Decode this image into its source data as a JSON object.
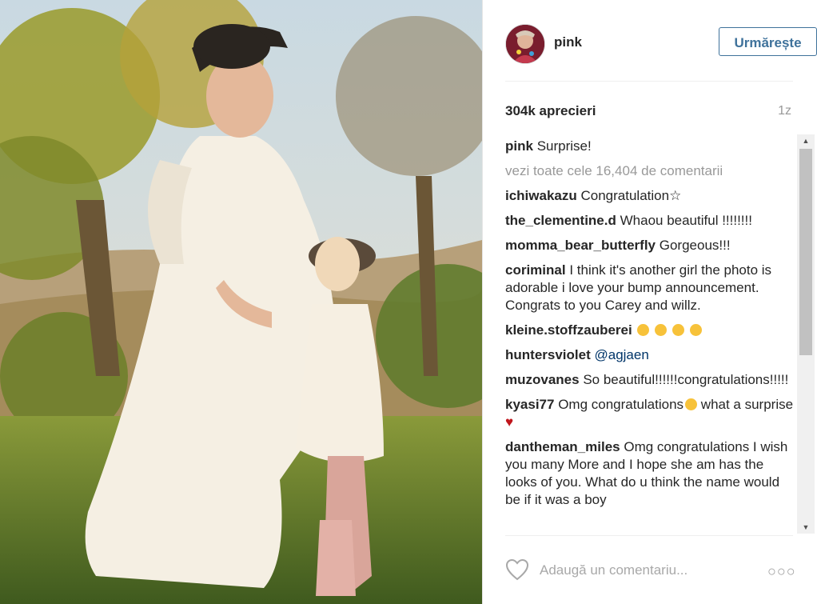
{
  "post": {
    "username": "pink",
    "follow_label": "Urmărește",
    "likes": "304k aprecieri",
    "time": "1z",
    "caption_user": "pink",
    "caption_text": "Surprise!",
    "view_all": "vezi toate cele 16,404 de comentarii",
    "add_comment_placeholder": "Adaugă un comentariu...",
    "more_glyph": "○○○"
  },
  "comments": [
    {
      "user": "ichiwakazu",
      "text": "Congratulation☆"
    },
    {
      "user": "the_clementine.d",
      "text": "Whaou beautiful !!!!!!!!"
    },
    {
      "user": "momma_bear_butterfly",
      "text": "Gorgeous!!!"
    },
    {
      "user": "coriminal",
      "text": "I think it's another girl the photo is adorable i love your bump announcement. Congrats to you Carey and willz."
    },
    {
      "user": "kleine.stoffzauberei",
      "text": ""
    },
    {
      "user": "huntersviolet",
      "text": "@agjaen"
    },
    {
      "user": "muzovanes",
      "text": "So beautiful!!!!!!congratulations!!!!!"
    },
    {
      "user": "kyasi77",
      "text": "Omg congratulations",
      "text_after": " what a surprise "
    },
    {
      "user": "dantheman_miles",
      "text": "Omg congratulations I wish you many More and I hope she am has the looks of you. What do u think the name would be if it was a boy"
    }
  ],
  "icons": {
    "heart": "heart-outline-icon",
    "more": "more-options-icon"
  },
  "colors": {
    "follow_blue": "#3f729b",
    "muted": "#999999",
    "heart_red": "#c0161c"
  }
}
